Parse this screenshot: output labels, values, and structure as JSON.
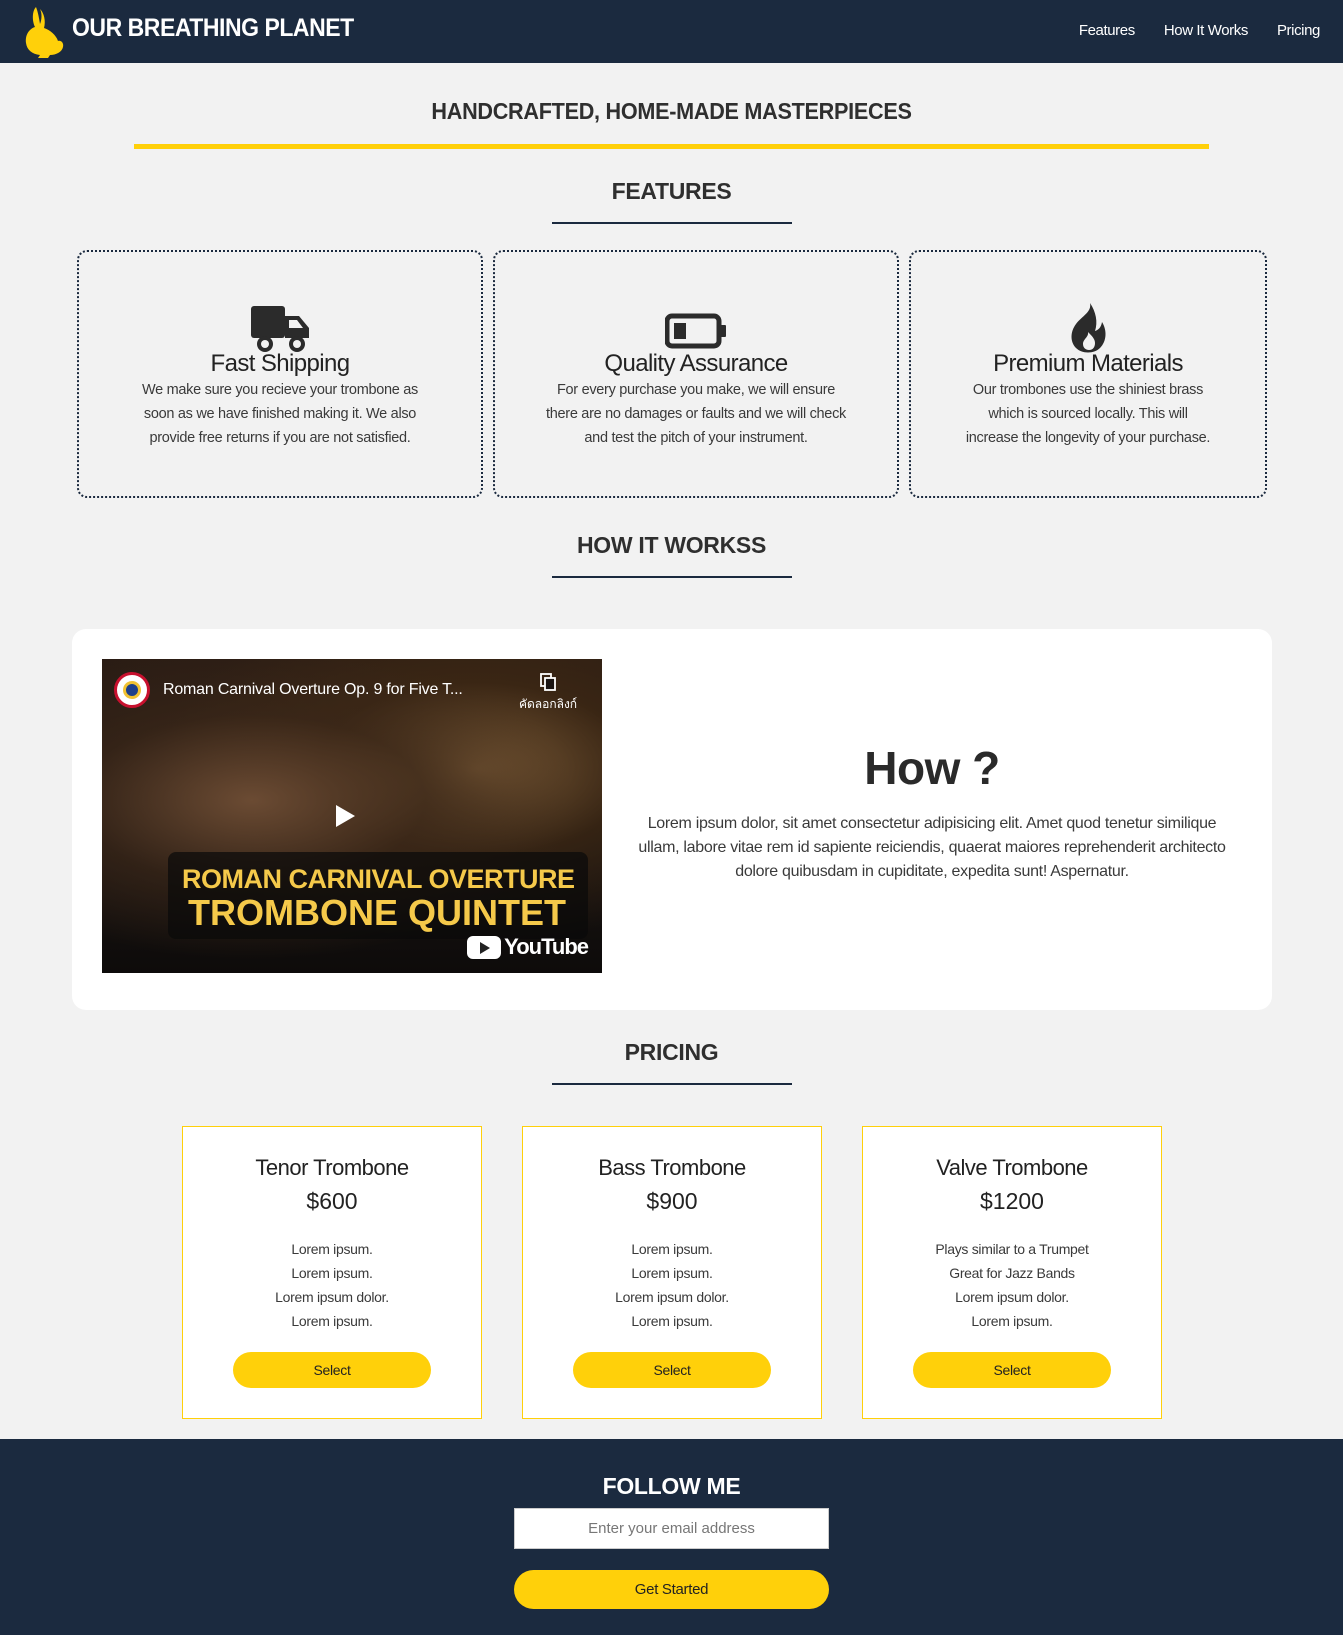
{
  "header": {
    "brand": "OUR BREATHING PLANET",
    "logo_icon": "rabbit-icon",
    "nav": [
      "Features",
      "How It Works",
      "Pricing"
    ]
  },
  "hero": {
    "title": "HANDCRAFTED, HOME-MADE MASTERPIECES"
  },
  "features": {
    "title": "FEATURES",
    "items": [
      {
        "icon": "truck-icon",
        "title": "Fast Shipping",
        "text": "We make sure you recieve your trombone as soon as we have finished making it. We also provide free returns if you are not satisfied."
      },
      {
        "icon": "battery-icon",
        "title": "Quality Assurance",
        "text": "For every purchase you make, we will ensure there are no damages or faults and we will check and test the pitch of your instrument."
      },
      {
        "icon": "fire-icon",
        "title": "Premium Materials",
        "text": "Our trombones use the shiniest brass which is sourced locally. This will increase the longevity of your purchase."
      }
    ]
  },
  "how": {
    "title": "HOW IT WORKSS",
    "video": {
      "title": "Roman Carnival Overture Op. 9 for Five T...",
      "copy_link": "คัดลอกลิงก์",
      "caption_line1": "ROMAN CARNIVAL OVERTURE",
      "caption_line2": "TROMBONE QUINTET",
      "platform": "YouTube"
    },
    "heading": "How ?",
    "text": "Lorem ipsum dolor, sit amet consectetur adipisicing elit. Amet quod tenetur similique ullam, labore vitae rem id sapiente reiciendis, quaerat maiores reprehenderit architecto dolore quibusdam in cupiditate, expedita sunt! Aspernatur."
  },
  "pricing": {
    "title": "PRICING",
    "plans": [
      {
        "name": "Tenor Trombone",
        "price": "$600",
        "features": [
          "Lorem ipsum.",
          "Lorem ipsum.",
          "Lorem ipsum dolor.",
          "Lorem ipsum."
        ],
        "button": "Select"
      },
      {
        "name": "Bass Trombone",
        "price": "$900",
        "features": [
          "Lorem ipsum.",
          "Lorem ipsum.",
          "Lorem ipsum dolor.",
          "Lorem ipsum."
        ],
        "button": "Select"
      },
      {
        "name": "Valve Trombone",
        "price": "$1200",
        "features": [
          "Plays similar to a Trumpet",
          "Great for Jazz Bands",
          "Lorem ipsum dolor.",
          "Lorem ipsum."
        ],
        "button": "Select"
      }
    ]
  },
  "footer": {
    "title": "FOLLOW ME",
    "email_placeholder": "Enter your email address",
    "button": "Get Started"
  },
  "colors": {
    "navy": "#1b2a3f",
    "accent": "#ffd00a",
    "background": "#f2f2f2"
  }
}
